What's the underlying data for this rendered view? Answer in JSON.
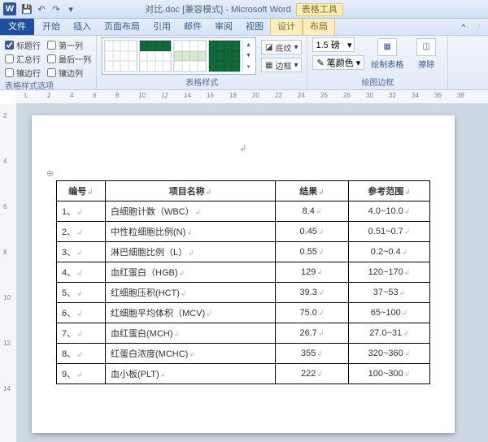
{
  "title": {
    "doc": "对比.doc",
    "mode": "[兼容模式]",
    "app": "Microsoft Word",
    "context_group": "表格工具"
  },
  "qat": {
    "save": "💾",
    "undo": "↶",
    "redo": "↷",
    "dd": "▾"
  },
  "tabs": {
    "file": "文件",
    "items": [
      "开始",
      "插入",
      "页面布局",
      "引用",
      "邮件",
      "审阅",
      "视图"
    ],
    "context": [
      "设计",
      "布局"
    ],
    "help_mini": "⌃",
    "help": "❔"
  },
  "ribbon": {
    "options": {
      "r1": [
        "标题行",
        "第一列"
      ],
      "r2": [
        "汇总行",
        "最后一列"
      ],
      "r3": [
        "镶边行",
        "镶边列"
      ],
      "label": "表格样式选项"
    },
    "styles_label": "表格样式",
    "shading": {
      "icon": "◪",
      "label": "底纹",
      "dd": "▾"
    },
    "border": {
      "icon": "▦",
      "label": "边框",
      "dd": "▾"
    },
    "pen": {
      "width": "1.5 磅",
      "dd": "▾",
      "color_icon": "✎",
      "color_label": "笔颜色",
      "color_dd": "▾"
    },
    "draw": {
      "icon": "▦✎",
      "label": "绘制表格"
    },
    "erase": {
      "icon": "◫⨉",
      "label": "擦除"
    },
    "borders_group": "绘图边框"
  },
  "ruler": {
    "h": [
      "L",
      "2",
      "4",
      "6",
      "8",
      "10",
      "12",
      "14",
      "16",
      "18",
      "20",
      "22",
      "24",
      "26",
      "28",
      "30",
      "32",
      "34",
      "36",
      "38"
    ],
    "v": [
      "2",
      "4",
      "6",
      "8",
      "10",
      "12",
      "14"
    ]
  },
  "table": {
    "headers": [
      "编号",
      "项目名称",
      "结果",
      "参考范围"
    ],
    "rows": [
      {
        "no": "1、",
        "name": "白细胞计数（WBC）",
        "val": "8.4",
        "ref": "4.0~10.0"
      },
      {
        "no": "2、",
        "name": "中性粒细胞比例(N)",
        "val": "0.45",
        "ref": "0.51~0.7"
      },
      {
        "no": "3、",
        "name": "淋巴细胞比例（L）",
        "val": "0.55",
        "ref": "0.2~0.4"
      },
      {
        "no": "4、",
        "name": "血红蛋白（HGB)",
        "val": "129",
        "ref": "120~170"
      },
      {
        "no": "5、",
        "name": "红细胞压积(HCT)",
        "val": "39.3",
        "ref": "37~53"
      },
      {
        "no": "6、",
        "name": "红细胞平均体积（MCV)",
        "val": "75.0",
        "ref": "65~100"
      },
      {
        "no": "7、",
        "name": "血红蛋白(MCH)",
        "val": "26.7",
        "ref": "27.0~31"
      },
      {
        "no": "8、",
        "name": "红蛋白浓度(MCHC)",
        "val": "355",
        "ref": "320~360"
      },
      {
        "no": "9、",
        "name": "血小板(PLT)",
        "val": "222",
        "ref": "100~300"
      }
    ],
    "cellmark": "↲",
    "para": "↲",
    "anchor": "⊕"
  },
  "colw": [
    "60px",
    "auto",
    "90px",
    "100px"
  ]
}
